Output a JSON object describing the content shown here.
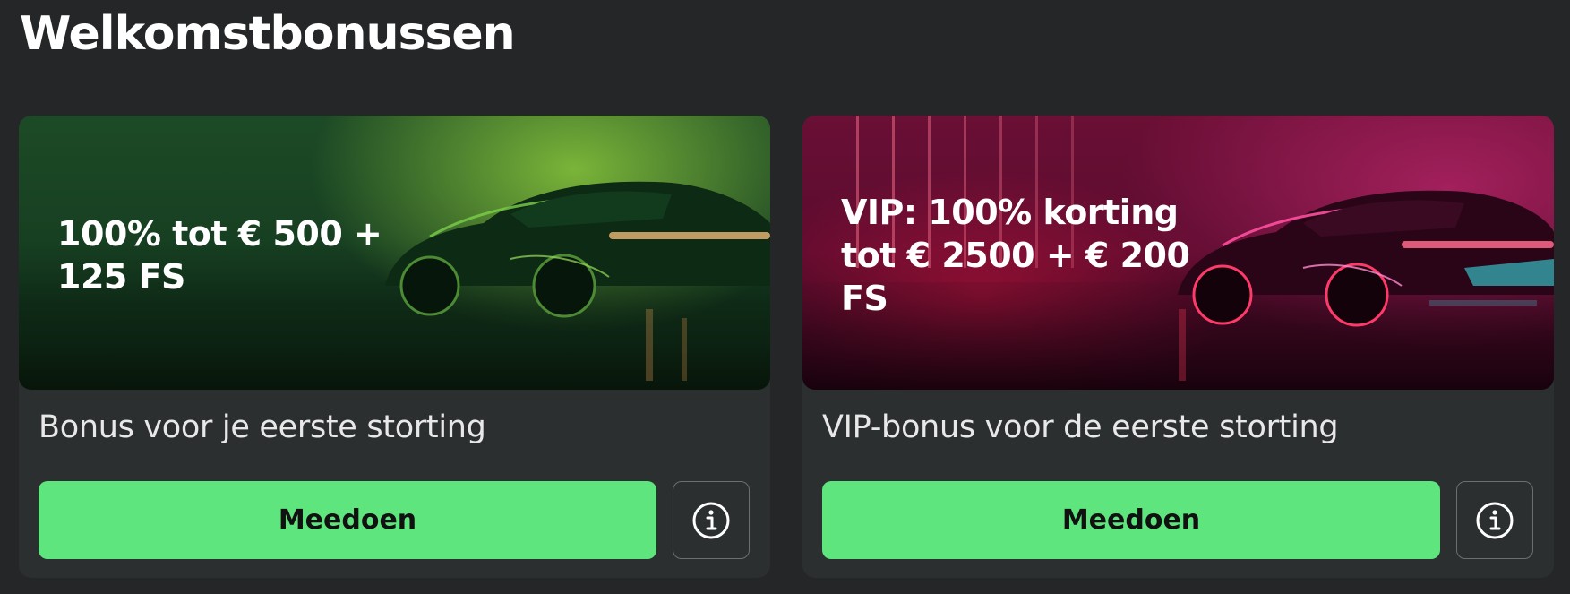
{
  "page": {
    "title": "Welkomstbonussen"
  },
  "cards": [
    {
      "banner_text": "100% tot € 500 + 125 FS",
      "title": "Bonus voor je eerste storting",
      "join_label": "Meedoen",
      "theme": "green",
      "accent": "#5fe57d"
    },
    {
      "banner_text": "VIP: 100% korting tot € 2500 + € 200 FS",
      "title": "VIP-bonus voor de eerste storting",
      "join_label": "Meedoen",
      "theme": "pink",
      "accent": "#5fe57d"
    }
  ],
  "icons": {
    "info": "info-icon"
  },
  "colors": {
    "background": "#242628",
    "card": "#2b2f30",
    "button": "#5fe57d"
  }
}
